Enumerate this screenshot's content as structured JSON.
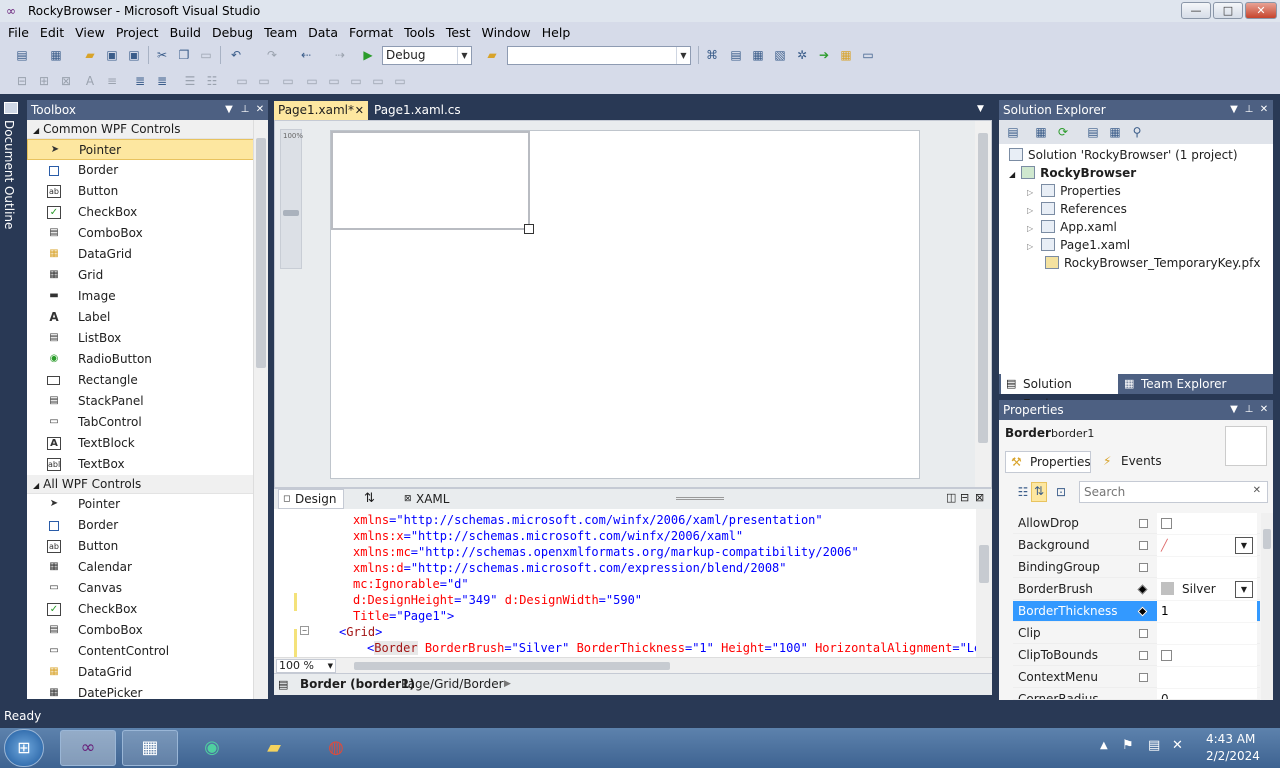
{
  "window": {
    "title": "RockyBrowser - Microsoft Visual Studio",
    "min": "—",
    "max": "□",
    "close": "✕"
  },
  "menu": [
    "File",
    "Edit",
    "View",
    "Project",
    "Build",
    "Debug",
    "Team",
    "Data",
    "Format",
    "Tools",
    "Test",
    "Window",
    "Help"
  ],
  "toolbar": {
    "config": "Debug",
    "platform": ""
  },
  "toolbox": {
    "title": "Toolbox",
    "groups": [
      {
        "name": "Common WPF Controls",
        "items": [
          "Pointer",
          "Border",
          "Button",
          "CheckBox",
          "ComboBox",
          "DataGrid",
          "Grid",
          "Image",
          "Label",
          "ListBox",
          "RadioButton",
          "Rectangle",
          "StackPanel",
          "TabControl",
          "TextBlock",
          "TextBox"
        ]
      },
      {
        "name": "All WPF Controls",
        "items": [
          "Pointer",
          "Border",
          "Button",
          "Calendar",
          "Canvas",
          "CheckBox",
          "ComboBox",
          "ContentControl",
          "DataGrid",
          "DatePicker"
        ]
      }
    ]
  },
  "doc_outline_label": "Document Outline",
  "editor": {
    "tabs": [
      "Page1.xaml*",
      "Page1.xaml.cs"
    ],
    "zoom_small": "100%",
    "design_tab": "Design",
    "swap_icon": "⇅",
    "xaml_tab": "XAML",
    "code": [
      {
        "a": "xmlns",
        "v": "\"http://schemas.microsoft.com/winfx/2006/xaml/presentation\""
      },
      {
        "a": "xmlns:x",
        "v": "\"http://schemas.microsoft.com/winfx/2006/xaml\""
      },
      {
        "a": "xmlns:mc",
        "v": "\"http://schemas.openxmlformats.org/markup-compatibility/2006\""
      },
      {
        "a": "xmlns:d",
        "v": "\"http://schemas.microsoft.com/expression/blend/2008\""
      },
      {
        "a": "mc:Ignorable",
        "v": "\"d\""
      },
      {
        "a": "d:DesignHeight",
        "v": "\"349\"",
        "a2": "d:DesignWidth",
        "v2": "\"590\""
      },
      {
        "a": "Title",
        "v": "\"Page1\"",
        "end": ">"
      }
    ],
    "grid_tag": "Grid",
    "border_line": {
      "tag": "Border",
      "a1": "BorderBrush",
      "v1": "\"Silver\"",
      "a2": "BorderThickness",
      "v2": "\"1\"",
      "a3": "Height",
      "v3": "\"100\"",
      "a4": "HorizontalAlignment",
      "v4": "\"Left"
    },
    "zoom": "100 %",
    "breadcrumb_bold": "Border (border1)",
    "breadcrumb_path": "Page/Grid/Border"
  },
  "solution_explorer": {
    "title": "Solution Explorer",
    "solution": "Solution 'RockyBrowser' (1 project)",
    "project": "RockyBrowser",
    "items": [
      "Properties",
      "References",
      "App.xaml",
      "Page1.xaml",
      "RockyBrowser_TemporaryKey.pfx"
    ],
    "tab1": "Solution Explorer",
    "tab2": "Team Explorer"
  },
  "properties": {
    "title": "Properties",
    "type": "Border",
    "name": "border1",
    "tab_properties": "Properties",
    "tab_events": "Events",
    "search_placeholder": "Search",
    "rows": [
      {
        "name": "AllowDrop",
        "value": ""
      },
      {
        "name": "Background",
        "value": ""
      },
      {
        "name": "BindingGroup",
        "value": ""
      },
      {
        "name": "BorderBrush",
        "value": "Silver"
      },
      {
        "name": "BorderThickness",
        "value": "1"
      },
      {
        "name": "Clip",
        "value": ""
      },
      {
        "name": "ClipToBounds",
        "value": ""
      },
      {
        "name": "ContextMenu",
        "value": ""
      },
      {
        "name": "CornerRadius",
        "value": "0"
      }
    ]
  },
  "status": "Ready",
  "tray": {
    "time": "4:43 AM",
    "date": "2/2/2024"
  }
}
